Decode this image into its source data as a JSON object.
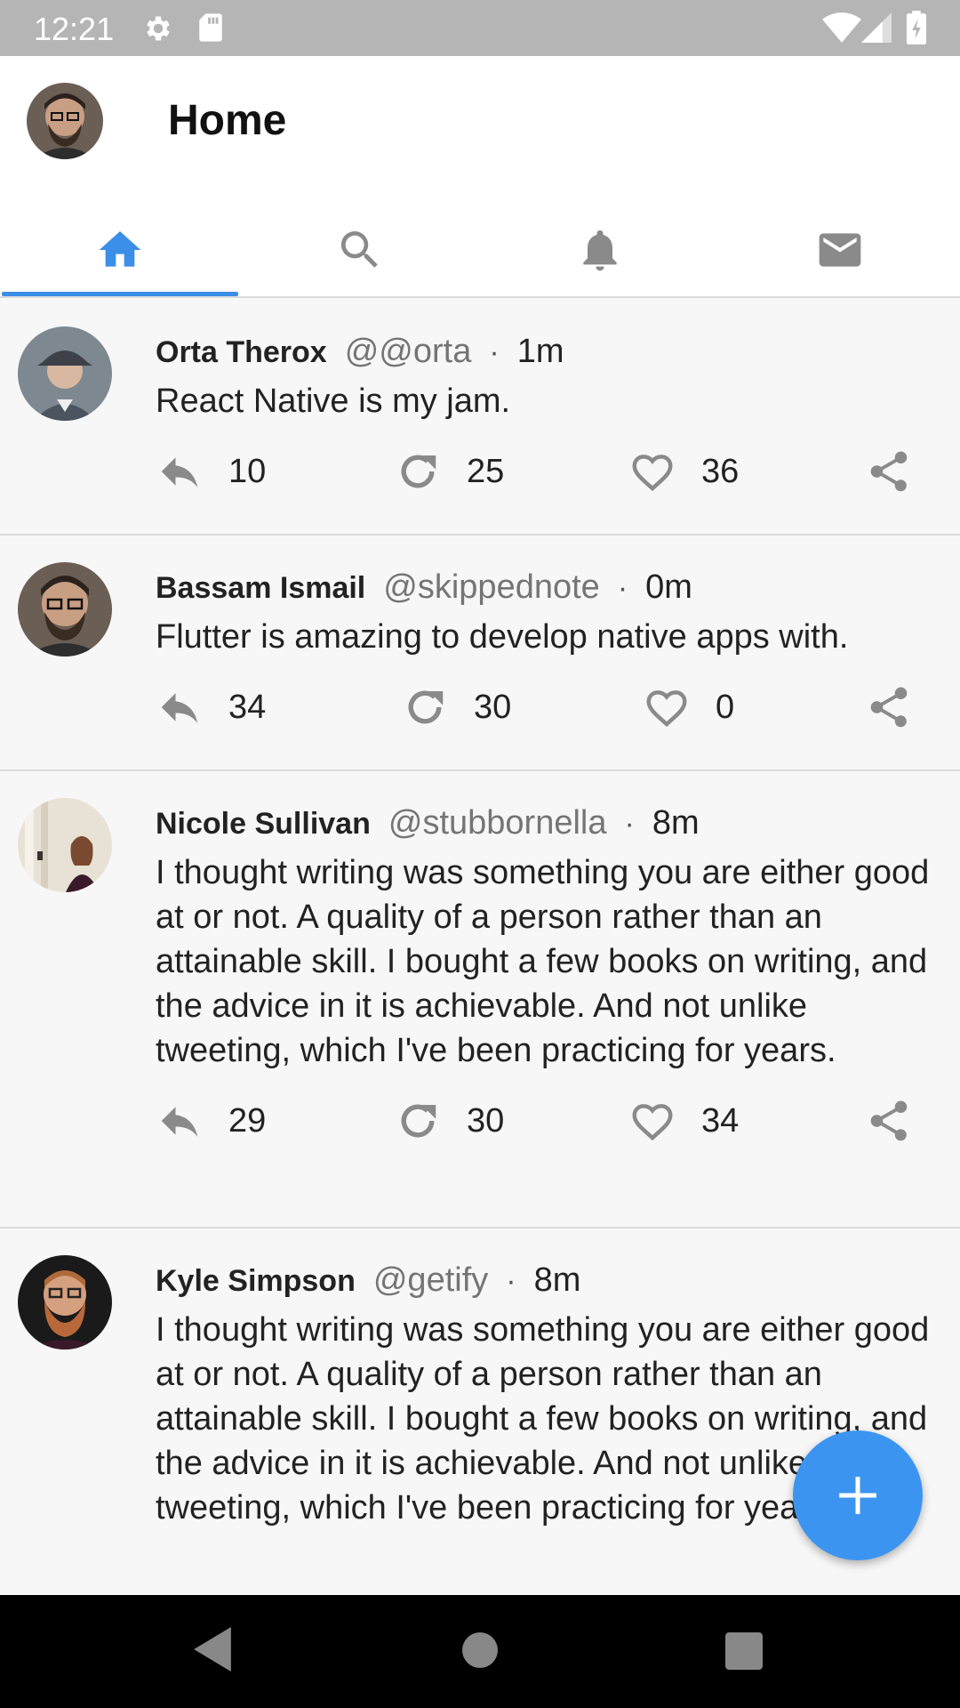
{
  "status_bar": {
    "time": "12:21",
    "icons": [
      "gear-icon",
      "sd-card-icon",
      "wifi-icon",
      "signal-icon",
      "battery-icon"
    ]
  },
  "header": {
    "title": "Home",
    "avatar": "user-avatar"
  },
  "tabs": [
    {
      "name": "home",
      "icon": "home-icon",
      "active": true
    },
    {
      "name": "search",
      "icon": "search-icon",
      "active": false
    },
    {
      "name": "notifications",
      "icon": "bell-icon",
      "active": false
    },
    {
      "name": "messages",
      "icon": "mail-icon",
      "active": false
    }
  ],
  "tweets": [
    {
      "author": "Orta Therox",
      "handle": "@@orta",
      "time": "1m",
      "text": "React Native is my jam.",
      "replies": "10",
      "retweets": "25",
      "likes": "36"
    },
    {
      "author": "Bassam Ismail",
      "handle": "@skippednote",
      "time": "0m",
      "text": "Flutter is amazing to develop native apps with.",
      "replies": "34",
      "retweets": "30",
      "likes": "0"
    },
    {
      "author": "Nicole Sullivan",
      "handle": "@stubbornella",
      "time": "8m",
      "text": "I thought writing was something you are either good at or not. A quality of a person rather than an attainable skill. I bought a few books on writing, and the advice in it is achievable. And not unlike tweeting, which I've been practicing for years.",
      "replies": "29",
      "retweets": "30",
      "likes": "34"
    },
    {
      "author": "Kyle Simpson",
      "handle": "@getify",
      "time": "8m",
      "text": "I thought writing was something you are either good at or not. A quality of a person rather than an attainable skill. I bought a few books on writing, and the advice in it is achievable. And not unlike tweeting, which I've been practicing for years.",
      "replies": "",
      "retweets": "",
      "likes": ""
    }
  ],
  "separator": "·",
  "fab": {
    "icon": "plus-icon"
  },
  "colors": {
    "accent": "#3b8fe8",
    "fab": "#3b95f0",
    "icon_gray": "#8a8a8a",
    "status_bar": "#b5b5b5"
  }
}
